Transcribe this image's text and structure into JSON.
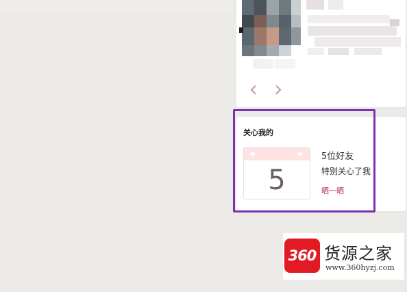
{
  "care_card": {
    "title": "关心我的",
    "calendar_number": "5",
    "friend_count": "5位好友",
    "friend_text": "特别关心了我",
    "share_link": "晒一晒"
  },
  "carousel": {
    "prev_icon": "chevron-left-icon",
    "next_icon": "chevron-right-icon"
  },
  "watermark": {
    "logo_text": "360",
    "name": "货源之家",
    "url": "www.360hyzj.com"
  },
  "colors": {
    "highlight": "#7e2fb0",
    "accent_link": "#b3344d",
    "calendar_header": "#ffe3e3",
    "logo_red": "#e21a23"
  }
}
